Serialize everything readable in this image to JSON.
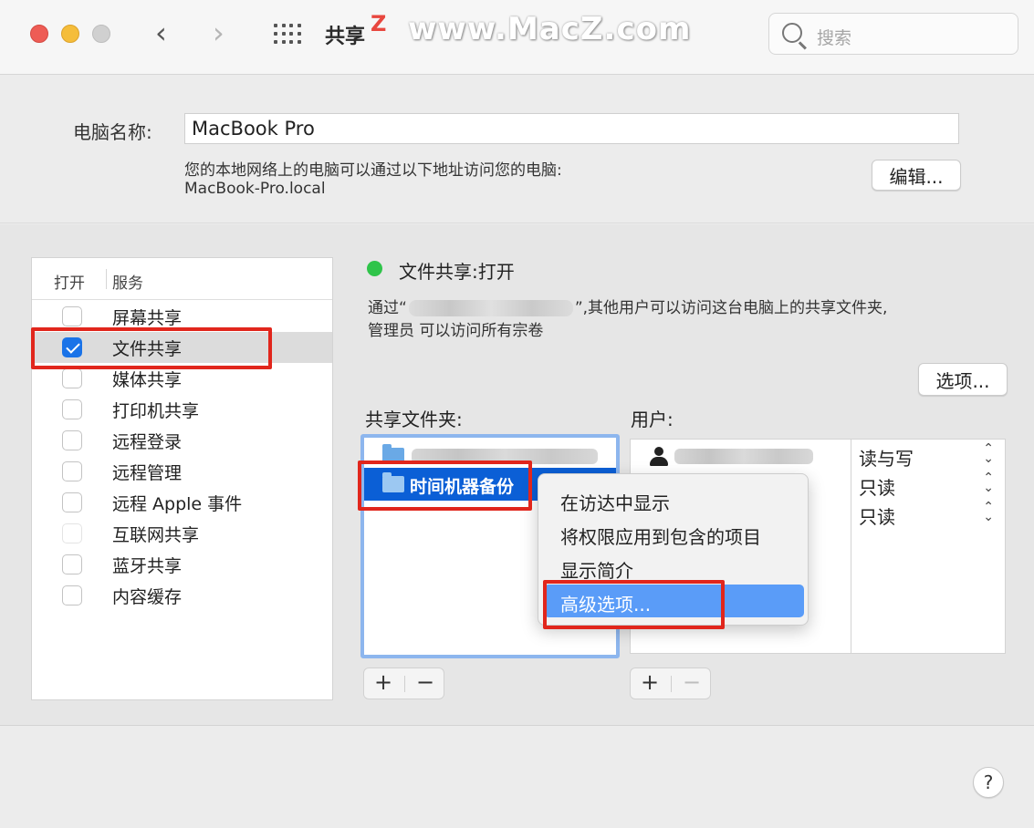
{
  "window": {
    "title": "共享",
    "search_placeholder": "搜索",
    "watermark_logo": "Z",
    "watermark_url": "www.MacZ.com",
    "back_glyph": "‹",
    "forward_glyph": "›"
  },
  "computer": {
    "label": "电脑名称:",
    "value": "MacBook Pro",
    "address_note": "您的本地网络上的电脑可以通过以下地址访问您的电脑:",
    "address": "MacBook-Pro.local",
    "edit_label": "编辑..."
  },
  "services": {
    "header_open": "打开",
    "header_service": "服务",
    "items": [
      {
        "label": "屏幕共享",
        "checked": false
      },
      {
        "label": "文件共享",
        "checked": true
      },
      {
        "label": "媒体共享",
        "checked": false
      },
      {
        "label": "打印机共享",
        "checked": false
      },
      {
        "label": "远程登录",
        "checked": false
      },
      {
        "label": "远程管理",
        "checked": false
      },
      {
        "label": "远程 Apple 事件",
        "checked": false
      },
      {
        "label": "互联网共享",
        "checked": false
      },
      {
        "label": "蓝牙共享",
        "checked": false
      },
      {
        "label": "内容缓存",
        "checked": false
      }
    ]
  },
  "detail": {
    "status": "文件共享:打开",
    "status_color": "#2fc44a",
    "desc_prefix": "通过“",
    "desc_suffix": "”,其他用户可以访问这台电脑上的共享文件夹,",
    "desc_line2": "管理员 可以访问所有宗卷",
    "options_label": "选项...",
    "folders_label": "共享文件夹:",
    "users_label": "用户:",
    "folders": [
      {
        "name": "",
        "selected": false
      },
      {
        "name": "时间机器备份",
        "selected": true
      }
    ],
    "permissions": [
      "读与写",
      "只读",
      "只读"
    ],
    "plus": "+",
    "minus": "−"
  },
  "context_menu": {
    "items": [
      {
        "label": "在访达中显示",
        "highlighted": false
      },
      {
        "label": "将权限应用到包含的项目",
        "highlighted": false
      },
      {
        "label": "显示简介",
        "highlighted": false
      },
      {
        "label": "高级选项...",
        "highlighted": true
      }
    ],
    "highlight_color": "#5a9cf8"
  },
  "help_label": "?",
  "annotation_color": "#e1261c"
}
